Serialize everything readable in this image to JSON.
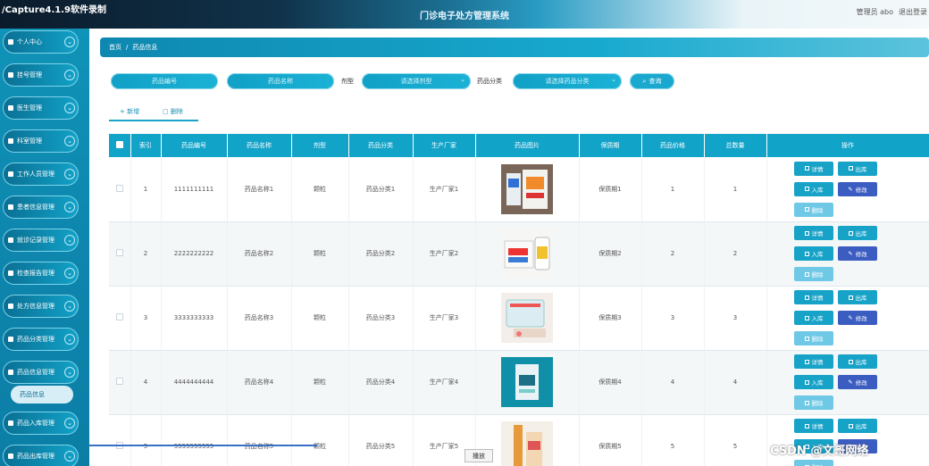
{
  "capture_title": "/Capture4.1.9软件录制",
  "app_title": "门诊电子处方管理系统",
  "user": {
    "label": "管理员 abo",
    "logout": "退出登录"
  },
  "sidebar": {
    "items": [
      {
        "label": "个人中心"
      },
      {
        "label": "挂号管理"
      },
      {
        "label": "医生管理"
      },
      {
        "label": "科室管理"
      },
      {
        "label": "工作人员管理"
      },
      {
        "label": "患者信息管理"
      },
      {
        "label": "就诊记录管理"
      },
      {
        "label": "检查报告管理"
      },
      {
        "label": "处方信息管理"
      },
      {
        "label": "药品分类管理"
      },
      {
        "label": "药品信息管理"
      },
      {
        "label": "药品入库管理"
      },
      {
        "label": "药品出库管理"
      }
    ],
    "active_sub": "药品信息"
  },
  "breadcrumb": {
    "home": "首页",
    "sep": "/",
    "current": "药品信息"
  },
  "filters": {
    "code_placeholder": "药品编号",
    "name_placeholder": "药品名称",
    "type_label": "剂型",
    "type_placeholder": "请选择剂型",
    "category_label": "药品分类",
    "category_placeholder": "请选择药品分类",
    "search_label": "查询"
  },
  "tabs": {
    "add": "新增",
    "delete": "删除"
  },
  "table": {
    "headers": [
      "索引",
      "药品编号",
      "药品名称",
      "剂型",
      "药品分类",
      "生产厂家",
      "药品图片",
      "保质期",
      "药品价格",
      "总数量",
      "操作"
    ],
    "rows": [
      {
        "idx": "1",
        "code": "1111111111",
        "name": "药品名称1",
        "type": "颗粒",
        "category": "药品分类1",
        "maker": "生产厂家1",
        "shelf": "保质期1",
        "price": "1",
        "qty": "1"
      },
      {
        "idx": "2",
        "code": "2222222222",
        "name": "药品名称2",
        "type": "颗粒",
        "category": "药品分类2",
        "maker": "生产厂家2",
        "shelf": "保质期2",
        "price": "2",
        "qty": "2"
      },
      {
        "idx": "3",
        "code": "3333333333",
        "name": "药品名称3",
        "type": "颗粒",
        "category": "药品分类3",
        "maker": "生产厂家3",
        "shelf": "保质期3",
        "price": "3",
        "qty": "3"
      },
      {
        "idx": "4",
        "code": "4444444444",
        "name": "药品名称4",
        "type": "颗粒",
        "category": "药品分类4",
        "maker": "生产厂家4",
        "shelf": "保质期4",
        "price": "4",
        "qty": "4"
      },
      {
        "idx": "5",
        "code": "5555555555",
        "name": "药品名称5",
        "type": "颗粒",
        "category": "药品分类5",
        "maker": "生产厂家5",
        "shelf": "保质期5",
        "price": "5",
        "qty": "5"
      }
    ],
    "ops": {
      "detail": "详情",
      "out": "出库",
      "in": "入库",
      "edit": "修改",
      "del": "删除"
    }
  },
  "overlay": {
    "watermark": "CSDN @文哥网络",
    "play_tip": "播放"
  }
}
